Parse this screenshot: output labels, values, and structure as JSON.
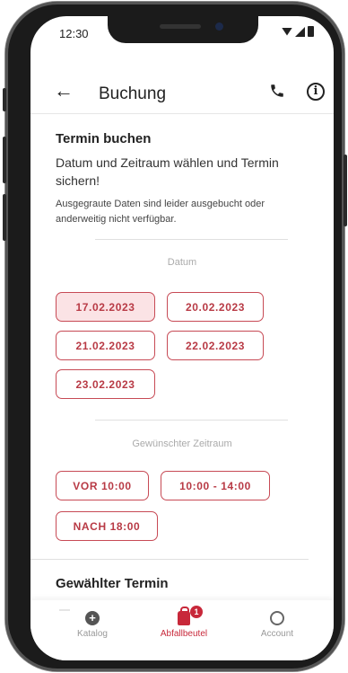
{
  "status_bar": {
    "time": "12:30"
  },
  "app_bar": {
    "title": "Buchung",
    "back_icon": "arrow-left-icon",
    "phone_icon": "phone-icon",
    "info_icon": "info-icon"
  },
  "intro": {
    "heading": "Termin buchen",
    "description": "Datum und Zeitraum wählen und Termin sichern!",
    "note": "Ausgegraute Daten sind leider ausgebucht oder anderweitig nicht verfügbar."
  },
  "dates": {
    "label": "Datum",
    "selected": "17.02.2023",
    "items": [
      "17.02.2023",
      "20.02.2023",
      "21.02.2023",
      "22.02.2023",
      "23.02.2023"
    ]
  },
  "time_slots": {
    "label": "Gewünschter Zeitraum",
    "items": [
      "VOR 10:00",
      "10:00 - 14:00",
      "NACH 18:00"
    ]
  },
  "selected_appointment": {
    "heading": "Gewählter Termin"
  },
  "bottom_nav": {
    "items": [
      {
        "label": "Katalog",
        "icon": "plus-circle-icon"
      },
      {
        "label": "Abfallbeutel",
        "icon": "bag-icon",
        "badge": "1",
        "active": true
      },
      {
        "label": "Account",
        "icon": "account-icon"
      }
    ]
  },
  "colors": {
    "accent": "#c8283a",
    "chip_border": "#c74a55",
    "chip_selected_bg": "#fbe3e5"
  }
}
